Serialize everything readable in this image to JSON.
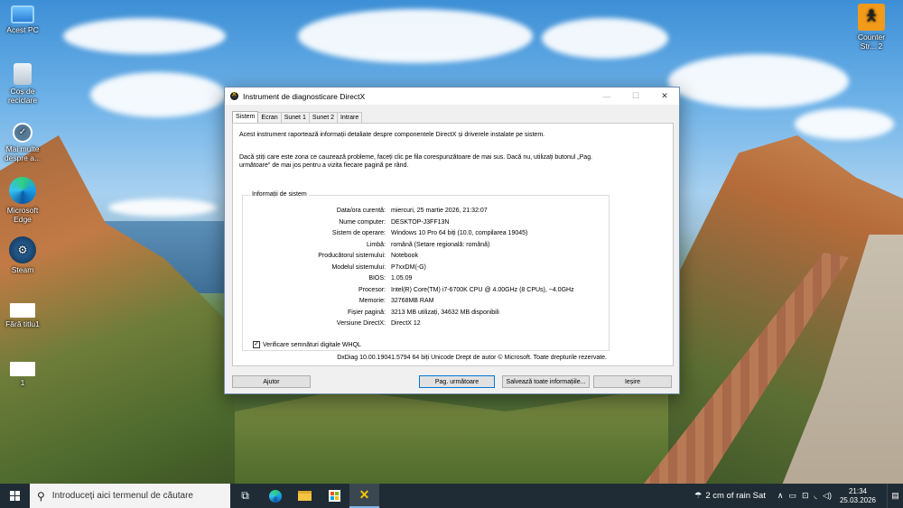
{
  "desktop": {
    "icons": [
      {
        "label": "Acest PC",
        "icon": "this-pc-icon"
      },
      {
        "label": "Coș de reciclare",
        "icon": "recycle-bin-icon"
      },
      {
        "label": "Mai multe despre a...",
        "icon": "info-icon"
      },
      {
        "label": "Microsoft Edge",
        "icon": "edge-icon"
      },
      {
        "label": "Steam",
        "icon": "steam-icon"
      },
      {
        "label": "Fără titlu1",
        "icon": "document-icon"
      },
      {
        "label": "1",
        "icon": "document-icon"
      },
      {
        "label": "Counter Str... 2",
        "icon": "counter-strike-icon"
      }
    ]
  },
  "window": {
    "title": "Instrument de diagnosticare DirectX",
    "controls": {
      "minimize": "—",
      "maximize": "☐",
      "close": "✕"
    },
    "tabs": [
      "Sistem",
      "Ecran",
      "Sunet 1",
      "Sunet 2",
      "Intrare"
    ],
    "active_tab": "Sistem",
    "intro": "Acest instrument raportează informații detaliate despre componentele DirectX și driverele instalate pe sistem.",
    "intro2": "Dacă știți care este zona ce cauzează probleme, faceți clic pe fila corespunzătoare de mai sus. Dacă nu, utilizați butonul „Pag. următoare\" de mai jos pentru a vizita fiecare pagină pe rând.",
    "group_title": "Informații de sistem",
    "info": [
      {
        "key": "Data/ora curentă:",
        "value": "miercuri, 25 martie 2026, 21:32:07"
      },
      {
        "key": "Nume computer:",
        "value": "DESKTOP-J3FF13N"
      },
      {
        "key": "Sistem de operare:",
        "value": "Windows 10 Pro 64 biți (10.0, compilarea 19045)"
      },
      {
        "key": "Limbă:",
        "value": "română (Setare regională: română)"
      },
      {
        "key": "Producătorul sistemului:",
        "value": "Notebook"
      },
      {
        "key": "Modelul sistemului:",
        "value": "P7xxDM(-G)"
      },
      {
        "key": "BIOS:",
        "value": "1.05.09"
      },
      {
        "key": "Procesor:",
        "value": "Intel(R) Core(TM) i7-6700K CPU @ 4.00GHz (8 CPUs), ~4.0GHz"
      },
      {
        "key": "Memorie:",
        "value": "32768MB RAM"
      },
      {
        "key": "Fișier pagină:",
        "value": "3213 MB utilizați, 34632 MB disponibili"
      },
      {
        "key": "Versiune DirectX:",
        "value": "DirectX 12"
      }
    ],
    "checkbox_label": "Verificare semnături digitale WHQL",
    "checkbox_checked": true,
    "footer": "DxDiag 10.00.19041.5794 64 biți Unicode  Drept de autor © Microsoft. Toate drepturile rezervate.",
    "buttons": {
      "help": "Ajutor",
      "next": "Pag. următoare",
      "save": "Salvează toate informațiile...",
      "exit": "Ieșire"
    }
  },
  "taskbar": {
    "search_placeholder": "Introduceți aici termenul de căutare",
    "pinned": [
      "task-view-icon",
      "edge-icon",
      "file-explorer-icon",
      "store-icon",
      "directx-icon"
    ],
    "weather": "2 cm of rain Sat",
    "time": "21:34",
    "date": "25.03.2026"
  }
}
